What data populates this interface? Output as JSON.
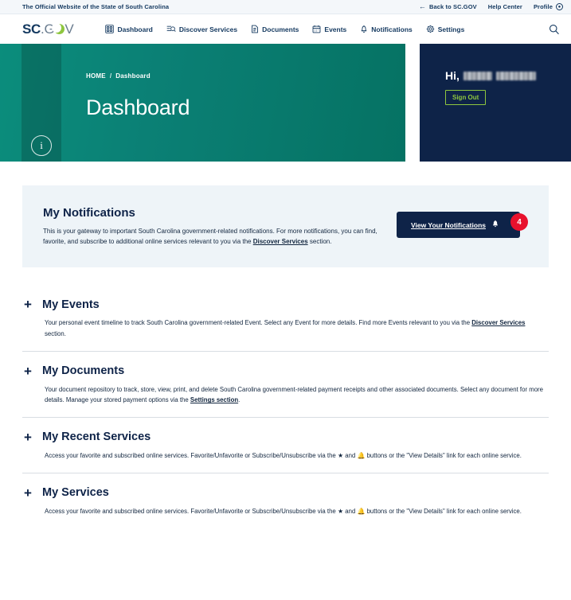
{
  "utility": {
    "official_text": "The Official Website of the State of South Carolina",
    "back_label": "Back to SC.GOV",
    "back_icon": "arrow-left-icon",
    "help_label": "Help Center",
    "profile_label": "Profile",
    "profile_icon": "user-circle-icon"
  },
  "header": {
    "logo": {
      "sc": "SC",
      "dot": ".",
      "g": "G",
      "moon_icon": "crescent-moon-icon",
      "v": "V"
    },
    "nav": [
      {
        "label": "Dashboard",
        "icon": "dashboard-grid-icon"
      },
      {
        "label": "Discover Services",
        "icon": "search-list-icon"
      },
      {
        "label": "Documents",
        "icon": "document-icon"
      },
      {
        "label": "Events",
        "icon": "calendar-icon"
      },
      {
        "label": "Notifications",
        "icon": "bell-icon"
      },
      {
        "label": "Settings",
        "icon": "gear-icon"
      }
    ],
    "search_icon": "search-icon"
  },
  "hero": {
    "info_icon": "info-circle-icon",
    "breadcrumb_home": "HOME",
    "breadcrumb_sep": "/",
    "breadcrumb_current": "Dashboard",
    "title": "Dashboard",
    "gradient_from": "#0b8d7c",
    "gradient_to": "#057263"
  },
  "user_panel": {
    "greeting": "Hi,",
    "name_redacted": true,
    "sign_out_label": "Sign Out",
    "background": "#0e2348",
    "accent": "#8ec63f"
  },
  "notifications_card": {
    "title": "My Notifications",
    "body_part1": "This is your gateway to important South Carolina government-related notifications. For more notifications, you can find, favorite, and subscribe to additional online services relevant to you via the ",
    "body_link": "Discover Services",
    "body_part2": " section.",
    "cta_label": "View Your Notifications",
    "cta_bell_icon": "bell-icon",
    "badge_count": "4",
    "badge_color": "#e8112d",
    "background": "#eef4f8"
  },
  "sections": [
    {
      "expand_icon": "plus-icon",
      "title": "My Events",
      "body_part1": "Your personal event timeline to track South Carolina government-related Event. Select any Event for more details. Find more Events relevant to you via the ",
      "body_link": "Discover Services",
      "body_part2": " section."
    },
    {
      "expand_icon": "plus-icon",
      "title": "My Documents",
      "body_part1": "Your document repository to track, store, view, print, and delete South Carolina government-related payment receipts and other associated documents. Select any document for more details. Manage your stored payment options via the ",
      "body_link": "Settings section",
      "body_part2": "."
    },
    {
      "expand_icon": "plus-icon",
      "title": "My Recent Services",
      "body_part1": "Access your favorite and subscribed online services. Favorite/Unfavorite or Subscribe/Unsubscribe via the ",
      "star_glyph": "★",
      "body_mid": " and ",
      "bell_glyph": "🔔",
      "body_part2": " buttons or the \"View Details\" link for each online service."
    },
    {
      "expand_icon": "plus-icon",
      "title": "My Services",
      "body_part1": "Access your favorite and subscribed online services. Favorite/Unfavorite or Subscribe/Unsubscribe via the ",
      "star_glyph": "★",
      "body_mid": " and ",
      "bell_glyph": "🔔",
      "body_part2": " buttons or the \"View Details\" link for each online service."
    }
  ]
}
